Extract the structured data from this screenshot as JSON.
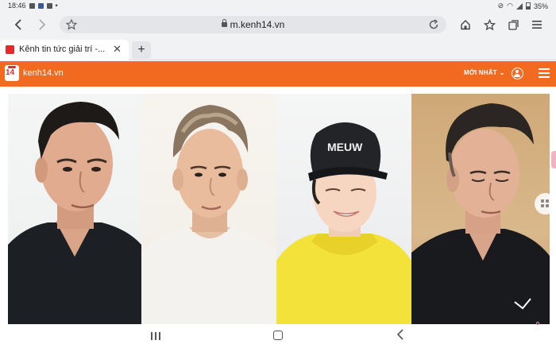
{
  "status_bar": {
    "time": "18:46",
    "battery": "35%"
  },
  "browser": {
    "url": "m.kenh14.vn",
    "tab": {
      "title": "Kênh tin tức giải trí -...",
      "close": "✕"
    },
    "new_tab": "+"
  },
  "site": {
    "logo_text": "14",
    "name": "kenh14.vn",
    "latest_label": "MỚI NHẤT",
    "brand_color": "#f26a20"
  },
  "article": {
    "cap_text": "MEUW"
  }
}
